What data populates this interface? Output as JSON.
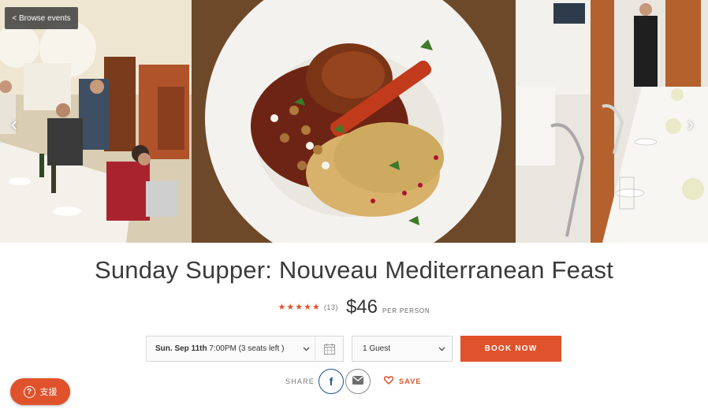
{
  "nav": {
    "browse_label": "< Browse events"
  },
  "hero": {
    "photos": [
      {
        "icon": "dinner-party-photo"
      },
      {
        "icon": "mediterranean-dish-photo"
      },
      {
        "icon": "dining-table-photo"
      }
    ],
    "arrow_left": "‹",
    "arrow_right": "›"
  },
  "event": {
    "title": "Sunday Supper: Nouveau Mediterranean Feast",
    "rating_stars": 5,
    "review_count": "(13)",
    "price": "$46",
    "price_unit": "PER PERSON"
  },
  "booking": {
    "date_day": "Sun. Sep 11th",
    "date_detail": "7:00PM (3 seats left )",
    "guests": "1 Guest",
    "book_label": "BOOK NOW"
  },
  "share": {
    "label": "SHARE",
    "facebook_glyph": "f",
    "save_label": "SAVE"
  },
  "support": {
    "label": "支援",
    "glyph": "?"
  },
  "colors": {
    "accent": "#e0522b",
    "facebook": "#1f4e91",
    "text": "#3b3b3b"
  }
}
